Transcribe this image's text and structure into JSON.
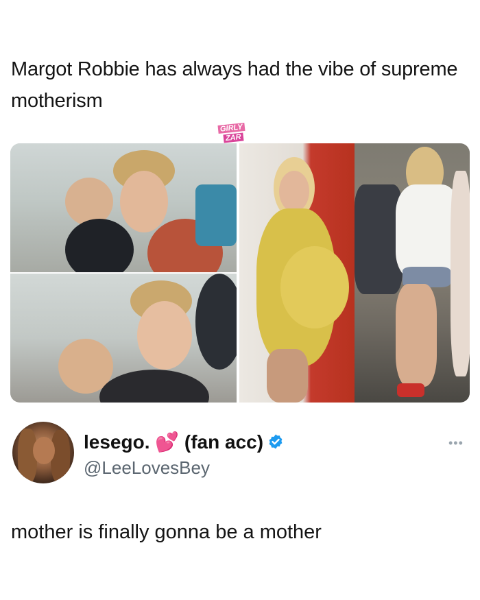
{
  "post": {
    "caption": "Margot Robbie has always had the vibe of supreme motherism"
  },
  "watermark": {
    "line1": "GIRLY",
    "line2": "ZAR"
  },
  "tweet": {
    "display_name": "lesego. 💕 (fan acc)",
    "handle": "@LeeLovesBey",
    "text": "mother is finally gonna be a mother",
    "more_icon": "more-options-icon",
    "verified_icon": "verified-badge-icon"
  },
  "colors": {
    "verified_blue": "#1d9bf0",
    "handle_gray": "#5b6670"
  }
}
